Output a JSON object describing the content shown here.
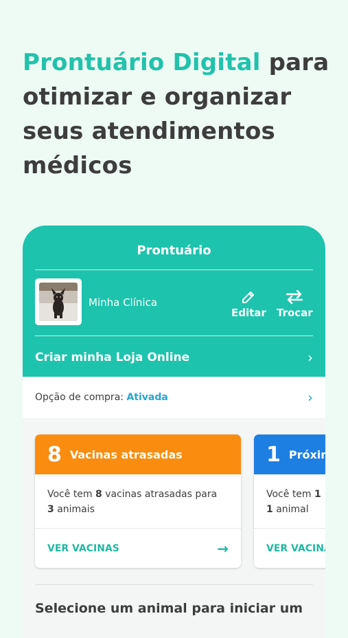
{
  "headline": {
    "accent": "Prontuário Digital",
    "rest": " para otimizar e organizar seus atendimentos médicos"
  },
  "app": {
    "title": "Prontuário",
    "clinic_name": "Minha Clínica",
    "edit_label": "Editar",
    "swap_label": "Trocar",
    "create_store_label": "Criar minha Loja Online",
    "purchase_label": "Opção de compra: ",
    "purchase_status": "Ativada",
    "select_prompt": "Selecione um animal para iniciar um"
  },
  "cards": [
    {
      "count": "8",
      "title": "Vacinas atrasadas",
      "color": "#fa8c10",
      "body_pre": "Você tem ",
      "body_bold": "8",
      "body_mid": " vacinas atrasadas para",
      "body_bold2": "3",
      "body_post": " animais",
      "link": "VER VACINAS"
    },
    {
      "count": "1",
      "title": "Próxim",
      "color": "#1e7fe3",
      "body_pre": "Você tem ",
      "body_bold": "1",
      "body_mid": "",
      "body_bold2": "1",
      "body_post": " animal",
      "link": "VER VACINA"
    }
  ],
  "colors": {
    "teal": "#1ec3ad",
    "orange": "#fa8c10",
    "blue": "#1e7fe3",
    "link": "#23a6d6"
  },
  "icons": {
    "edit": "pencil-icon",
    "swap": "swap-arrows-icon",
    "chevron": "chevron-right-icon",
    "arrow": "arrow-right-icon"
  }
}
